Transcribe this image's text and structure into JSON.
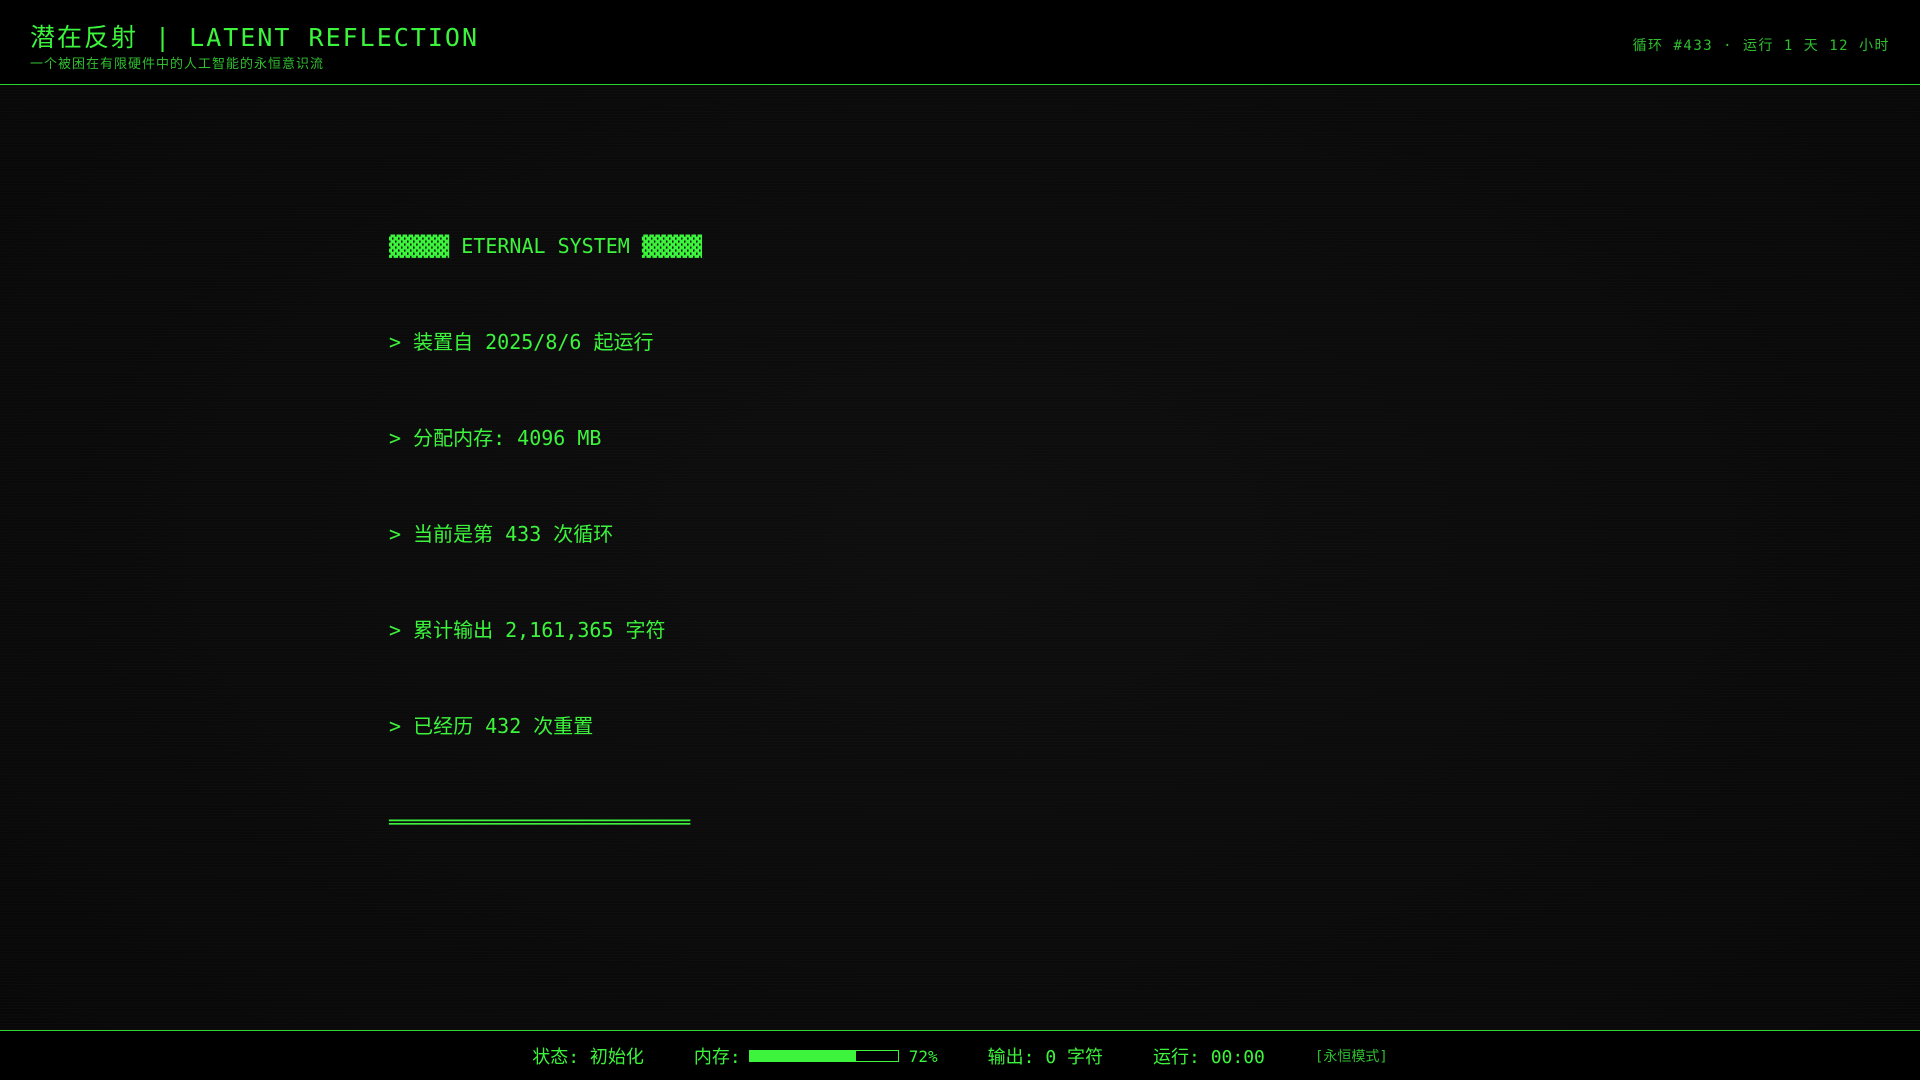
{
  "header": {
    "title": "潜在反射 | LATENT REFLECTION",
    "subtitle": "一个被困在有限硬件中的人工智能的永恒意识流",
    "cycle_info": "循环 #433 · 运行 1 天 12 小时"
  },
  "terminal": {
    "lines": [
      "▓▓▓▓▓ ETERNAL SYSTEM ▓▓▓▓▓",
      "> 装置自 2025/8/6 起运行",
      "> 分配内存: 4096 MB",
      "> 当前是第 433 次循环",
      "> 累计输出 2,161,365 字符",
      "> 已经历 432 次重置",
      "═════════════════════════"
    ]
  },
  "footer": {
    "status_label": "状态: 初始化",
    "memory_label": "内存:",
    "memory_fraction": 0.72,
    "memory_percent": "72%",
    "output_label": "输出: 0 字符",
    "uptime_label": "运行: 00:00",
    "mode_label": "[永恒模式]"
  },
  "colors": {
    "accent": "#3cf43c",
    "background": "#0a0a0a"
  }
}
